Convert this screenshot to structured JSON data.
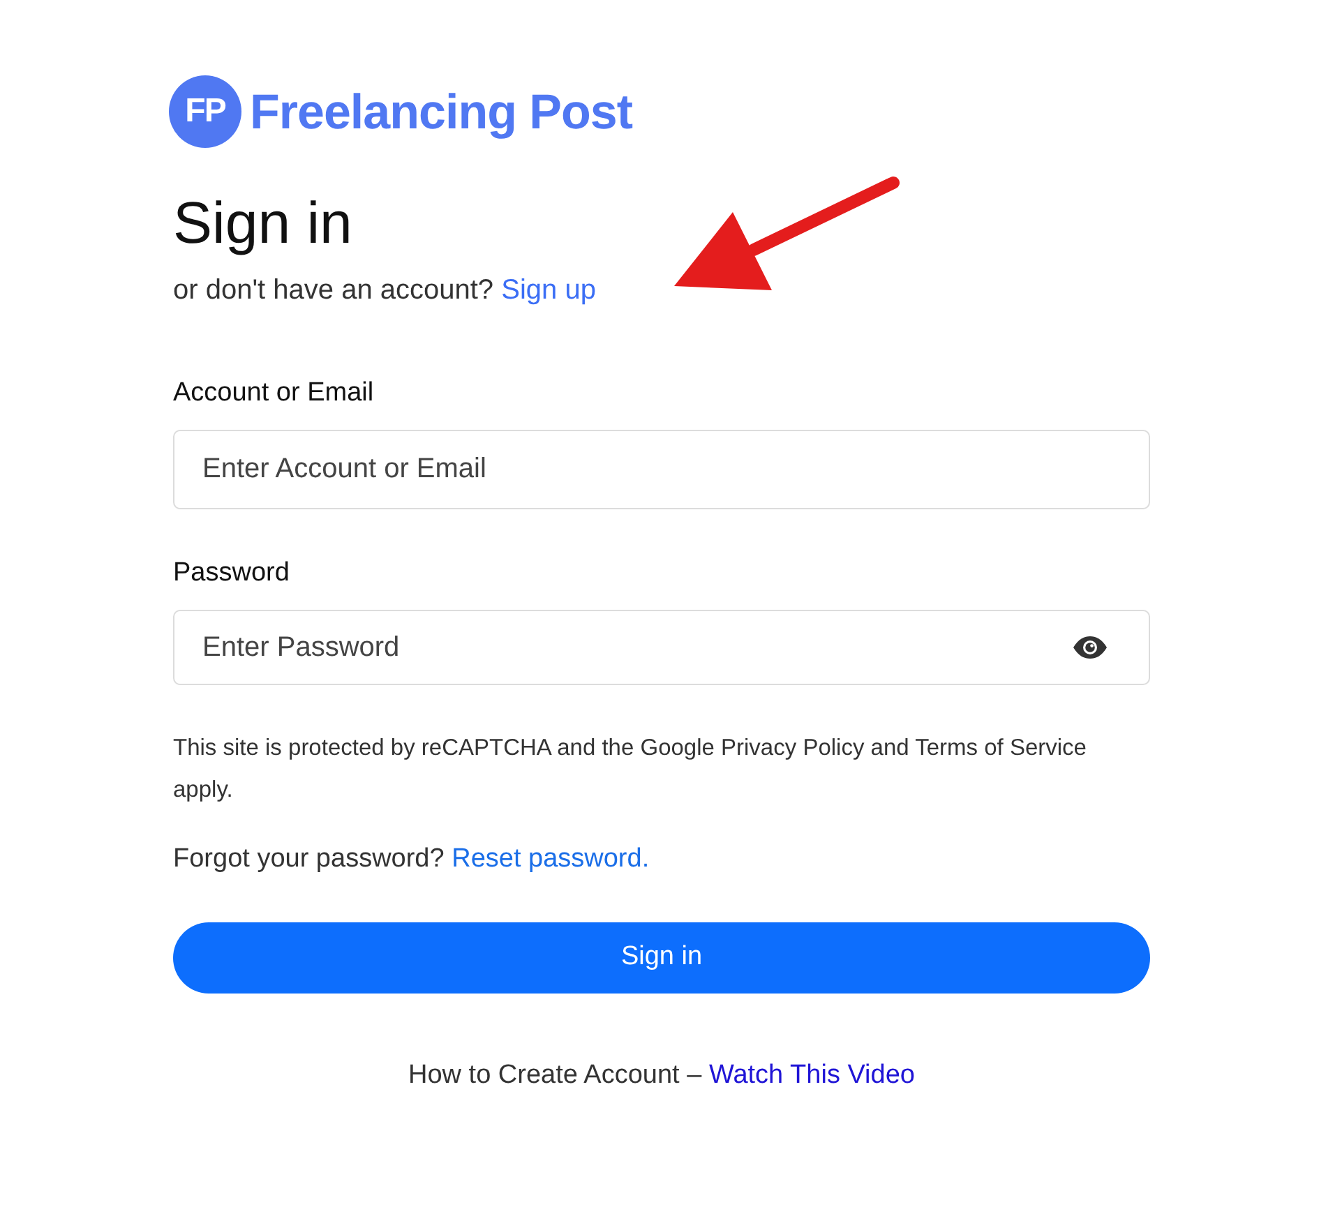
{
  "logo": {
    "badge": "FP",
    "name": "Freelancing Post"
  },
  "heading": "Sign in",
  "subtitle": {
    "text": "or don't have an account?",
    "link": "Sign up"
  },
  "fields": [
    {
      "kind": "text",
      "label": "Account or Email",
      "placeholder": "Enter Account or Email"
    },
    {
      "kind": "password",
      "label": "Password",
      "placeholder": "Enter Password"
    }
  ],
  "notice": "This site is protected by reCAPTCHA and the Google Privacy Policy and Terms of Service apply.",
  "forgot": {
    "text": "Forgot your password?",
    "link": "Reset password."
  },
  "submit_button": "Sign in",
  "footer": {
    "text": "How to Create Account –",
    "link": "Watch This Video"
  },
  "annotations": [
    {
      "kind": "arrow"
    }
  ]
}
